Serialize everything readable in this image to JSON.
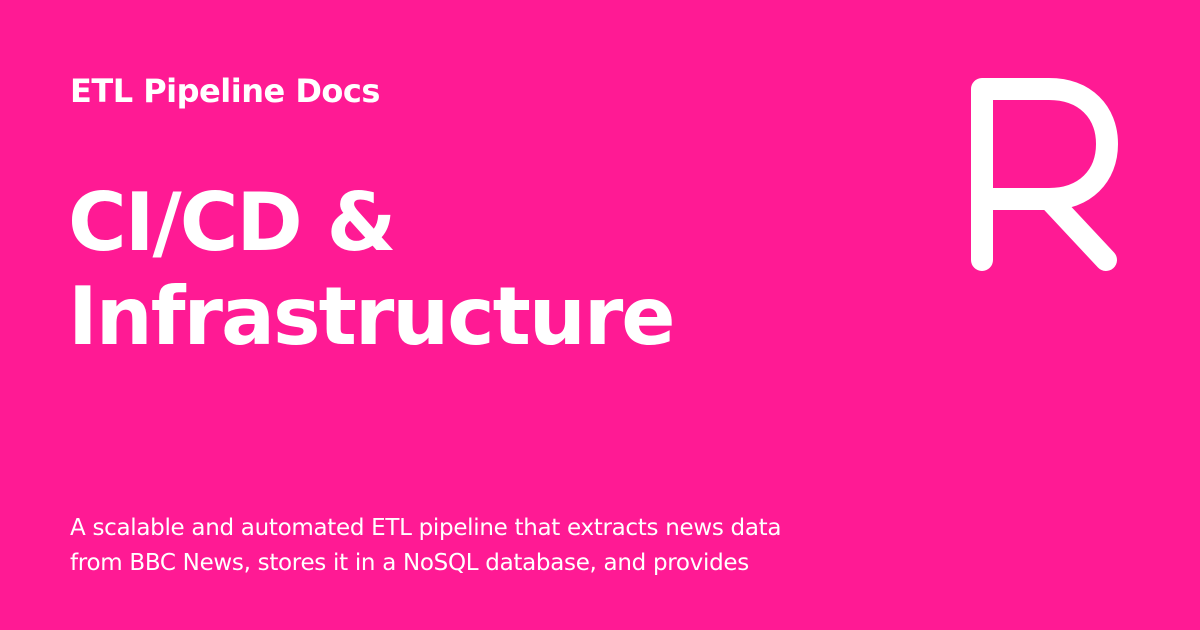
{
  "theme": {
    "background": "#ff1a94",
    "text": "#ffffff"
  },
  "header": {
    "site_name": "ETL Pipeline Docs",
    "logo_icon": "r-letter-logo-icon"
  },
  "main": {
    "title_lines": [
      "CI/CD &",
      "Infrastructure"
    ],
    "description_lines": [
      "A scalable and automated ETL pipeline that extracts news data",
      "from BBC News, stores it in a NoSQL database, and provides"
    ]
  }
}
